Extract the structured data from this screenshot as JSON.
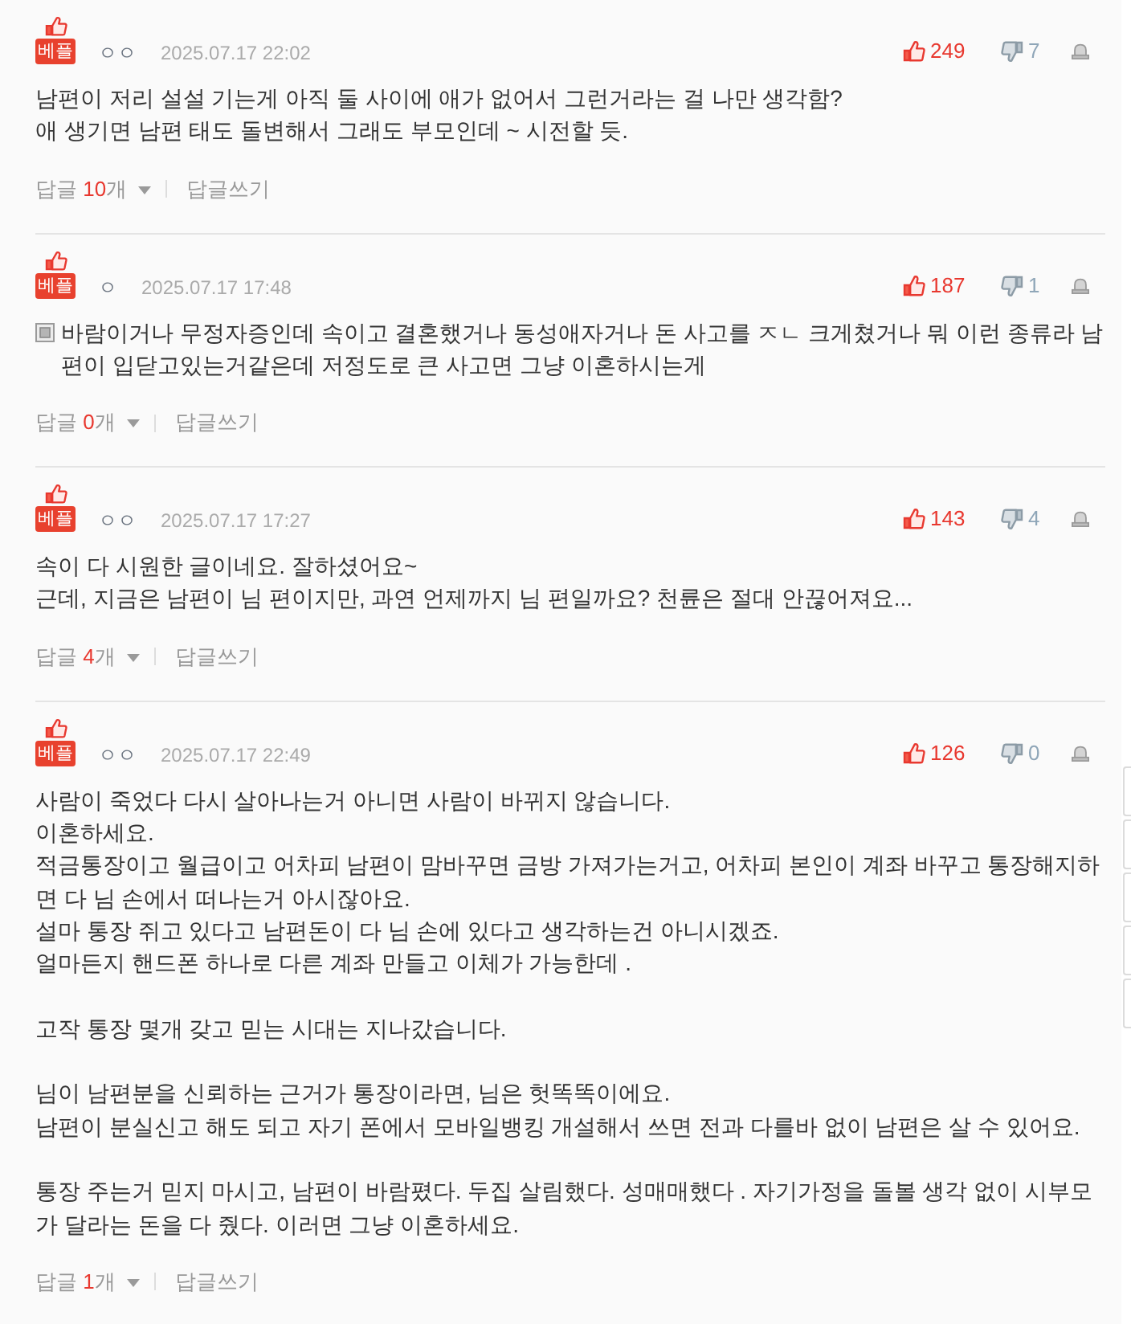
{
  "comments": [
    {
      "badge": "베플",
      "author": "ㅇㅇ",
      "date": "2025.07.17 22:02",
      "likes": "249",
      "dislikes": "7",
      "doc_icon": false,
      "paragraphs": [
        "남편이 저리 설설 기는게 아직 둘 사이에 애가 없어서 그런거라는 걸 나만 생각함?\n애 생기면 남편 태도 돌변해서 그래도 부모인데 ~ 시전할 듯."
      ],
      "replies": {
        "label": "답글",
        "count": "10",
        "unit": "개"
      },
      "write_reply": "답글쓰기"
    },
    {
      "badge": "베플",
      "author": "ㅇ",
      "date": "2025.07.17 17:48",
      "likes": "187",
      "dislikes": "1",
      "doc_icon": true,
      "paragraphs": [
        "바람이거나 무정자증인데 속이고 결혼했거나 동성애자거나 돈 사고를 ㅈㄴ 크게쳤거나 뭐 이런 종류라 남편이 입닫고있는거같은데 저정도로 큰 사고면 그냥 이혼하시는게"
      ],
      "replies": {
        "label": "답글",
        "count": "0",
        "unit": "개"
      },
      "write_reply": "답글쓰기"
    },
    {
      "badge": "베플",
      "author": "ㅇㅇ",
      "date": "2025.07.17 17:27",
      "likes": "143",
      "dislikes": "4",
      "doc_icon": false,
      "paragraphs": [
        "속이 다 시원한 글이네요. 잘하셨어요~\n근데, 지금은 남편이 님 편이지만, 과연 언제까지 님 편일까요? 천륜은 절대 안끊어져요..."
      ],
      "replies": {
        "label": "답글",
        "count": "4",
        "unit": "개"
      },
      "write_reply": "답글쓰기"
    },
    {
      "badge": "베플",
      "author": "ㅇㅇ",
      "date": "2025.07.17 22:49",
      "likes": "126",
      "dislikes": "0",
      "doc_icon": false,
      "paragraphs": [
        "사람이 죽었다 다시 살아나는거 아니면 사람이 바뀌지 않습니다.\n이혼하세요.\n적금통장이고 월급이고 어차피 남편이 맘바꾸면 금방 가져가는거고, 어차피 본인이 계좌 바꾸고 통장해지하면 다 님 손에서 떠나는거 아시잖아요.\n설마 통장 쥐고 있다고 남편돈이 다 님 손에 있다고 생각하는건 아니시겠죠.\n얼마든지 핸드폰 하나로 다른 계좌 만들고 이체가 가능한데 .",
        "고작 통장 몇개 갖고 믿는 시대는 지나갔습니다.",
        "님이 남편분을 신뢰하는 근거가 통장이라면, 님은 헛똑똑이에요.\n남편이 분실신고 해도 되고 자기 폰에서 모바일뱅킹 개설해서 쓰면 전과 다를바 없이 남편은 살 수 있어요.",
        "통장 주는거 믿지 마시고, 남편이 바람폈다. 두집 살림했다. 성매매했다 . 자기가정을 돌볼 생각 없이 시부모가 달라는 돈을 다 줬다. 이러면 그냥 이혼하세요."
      ],
      "replies": {
        "label": "답글",
        "count": "1",
        "unit": "개"
      },
      "write_reply": "답글쓰기"
    }
  ]
}
